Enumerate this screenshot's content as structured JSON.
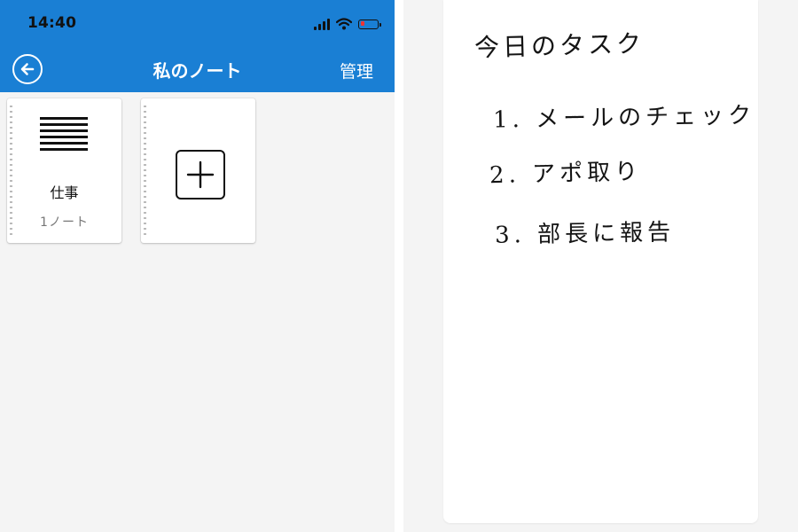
{
  "status_bar": {
    "time": "14:40",
    "icons": [
      "signal-icon",
      "wifi-icon",
      "battery-low-icon"
    ],
    "battery_level": 0.25
  },
  "header": {
    "title": "私のノート",
    "back_icon": "back-arrow-icon",
    "manage_label": "管理"
  },
  "notebooks": [
    {
      "name": "仕事",
      "count": "1ノート",
      "icon": "lines-icon"
    },
    {
      "icon": "plus-icon"
    }
  ],
  "note": {
    "title": "今日のタスク",
    "tasks": [
      "1. メールのチェック",
      "2. アポ取り",
      "3. 部長に報告"
    ]
  },
  "colors": {
    "accent": "#1a7fd4",
    "background": "#f4f4f4",
    "paper": "#ffffff",
    "ink": "#141414"
  }
}
